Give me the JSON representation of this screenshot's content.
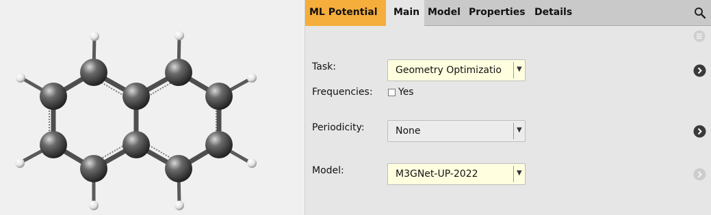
{
  "tabs": {
    "module": "ML Potential",
    "items": [
      {
        "label": "Main"
      },
      {
        "label": "Model"
      },
      {
        "label": "Properties"
      },
      {
        "label": "Details"
      }
    ]
  },
  "form": {
    "task": {
      "label": "Task:",
      "value": "Geometry Optimizatio"
    },
    "frequencies": {
      "label": "Frequencies:",
      "option": "Yes",
      "checked": false
    },
    "periodicity": {
      "label": "Periodicity:",
      "value": "None"
    },
    "model": {
      "label": "Model:",
      "value": "M3GNet-UP-2022"
    }
  },
  "icons": {
    "search": "search-icon",
    "menu": "menu-icon",
    "next": "chevron-right-icon",
    "dropdown": "triangle-down-icon"
  },
  "colors": {
    "module_tab": "#f5ad3c",
    "field_highlight": "#ffffe0",
    "carbon": "#555555",
    "hydrogen": "#ffffff"
  },
  "molecule": {
    "name_shown": false,
    "carbon_atoms": 10,
    "hydrogen_atoms": 8
  }
}
